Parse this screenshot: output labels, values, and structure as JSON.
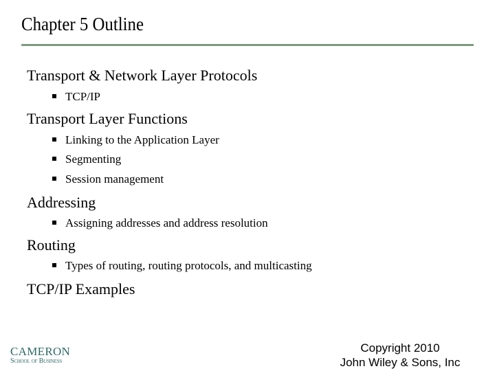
{
  "slide": {
    "title": "Chapter 5 Outline",
    "rule_color": "#7f9a80",
    "outline": [
      {
        "heading": "Transport & Network Layer Protocols",
        "items": [
          "TCP/IP"
        ]
      },
      {
        "heading": "Transport Layer Functions",
        "items": [
          "Linking to the Application Layer",
          "Segmenting",
          "Session management"
        ]
      },
      {
        "heading": "Addressing",
        "items": [
          "Assigning addresses and address resolution"
        ]
      },
      {
        "heading": "Routing",
        "items": [
          "Types of routing, routing protocols, and multicasting"
        ]
      },
      {
        "heading": "TCP/IP Examples",
        "items": []
      }
    ],
    "bullet_icon": "square-bullet-icon"
  },
  "footer": {
    "logo": {
      "main": "CAMERON",
      "sub": "School of Business",
      "color": "#2d6a66"
    },
    "copyright": {
      "line1": "Copyright 2010",
      "line2": "John Wiley & Sons, Inc"
    }
  }
}
